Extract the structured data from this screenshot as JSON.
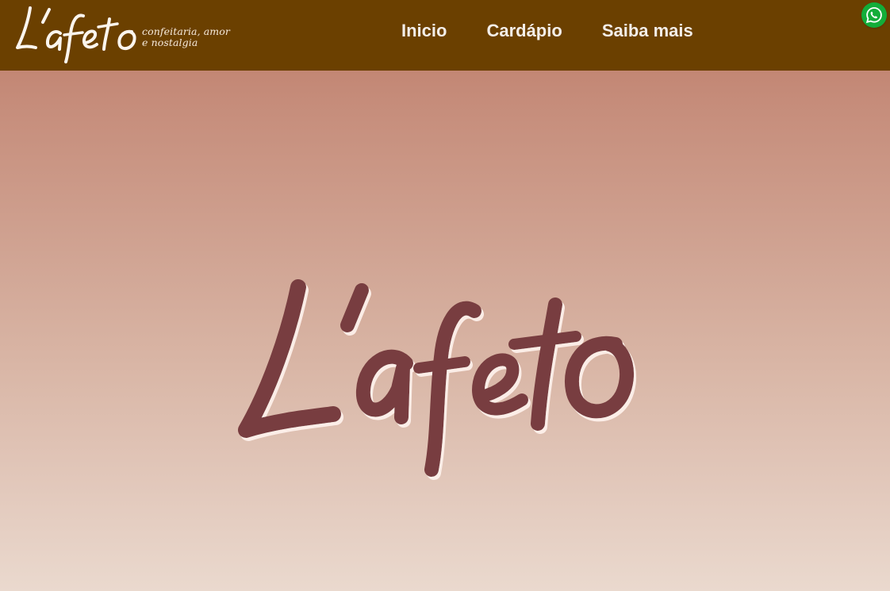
{
  "header": {
    "brand": {
      "wordmark": "L'afeto",
      "tagline_line1": "confeitaria, amor",
      "tagline_line2": "e nostalgia"
    },
    "nav": [
      {
        "label": "Inicio"
      },
      {
        "label": "Cardápio"
      },
      {
        "label": "Saiba mais"
      }
    ],
    "whatsapp_icon": "whatsapp-icon"
  },
  "hero": {
    "logo_text": "L'afeto"
  },
  "colors": {
    "header_bg": "#6b4000",
    "hero_top": "#bb7a67",
    "hero_bottom": "#ead9ce",
    "logo_fill": "#783e3f",
    "whatsapp_green": "#13ad39"
  }
}
